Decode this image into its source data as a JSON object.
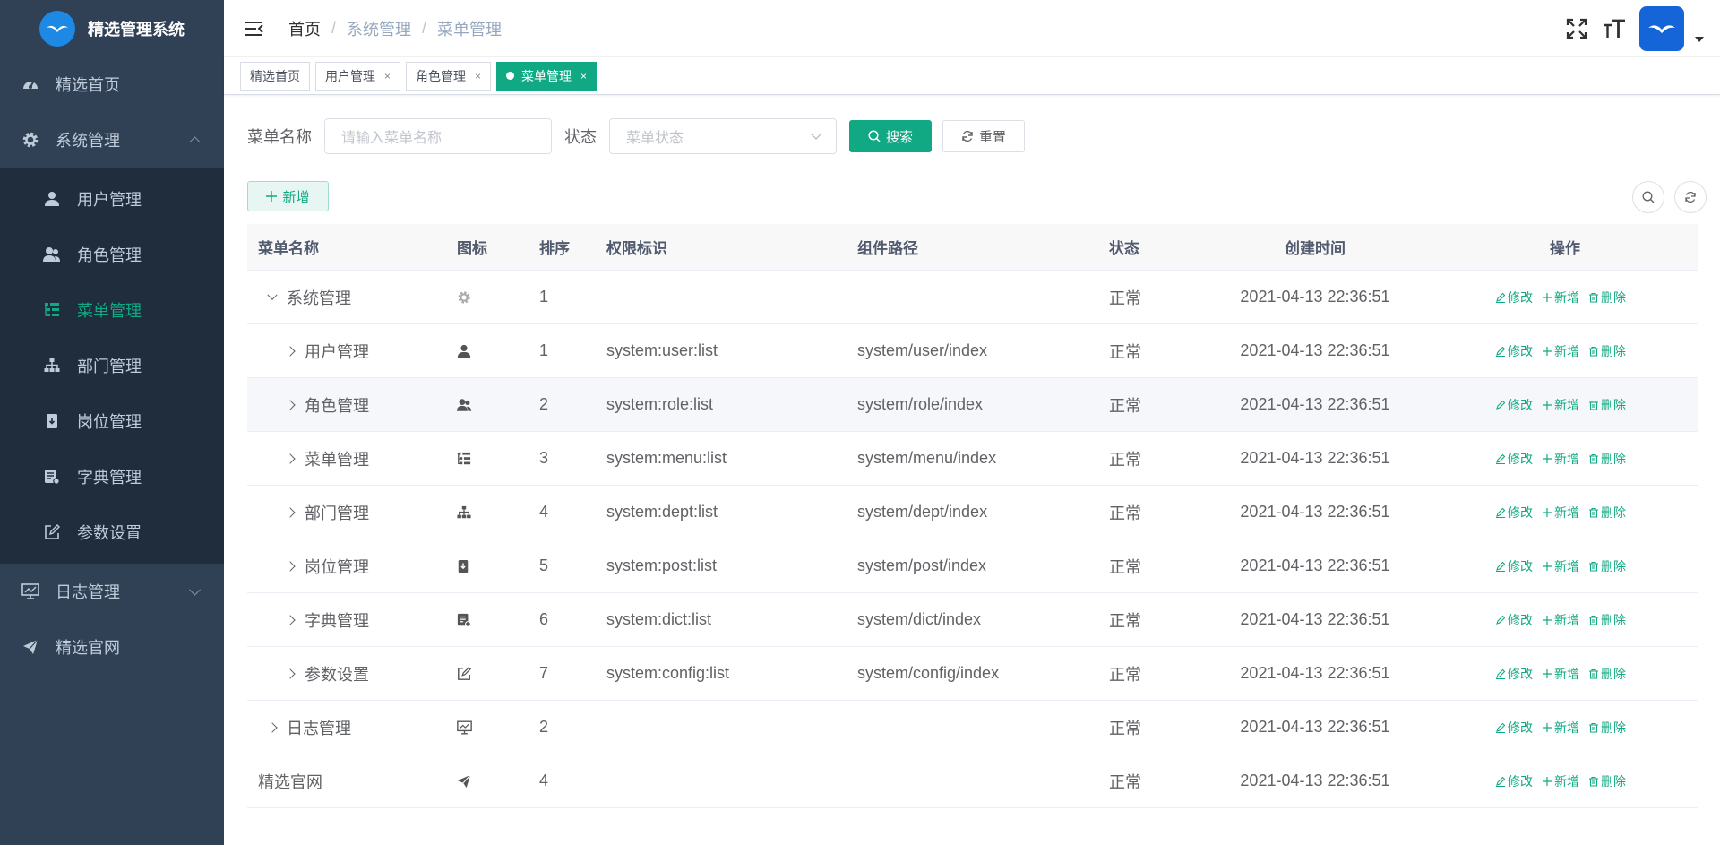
{
  "app": {
    "title": "精选管理系统"
  },
  "sidebar": {
    "items": [
      {
        "label": "精选首页",
        "icon": "dashboard-icon"
      },
      {
        "label": "系统管理",
        "icon": "gear-icon",
        "expanded": true
      },
      {
        "label": "日志管理",
        "icon": "monitor-icon",
        "expanded": false
      },
      {
        "label": "精选官网",
        "icon": "send-icon"
      }
    ],
    "sub": [
      {
        "label": "用户管理",
        "icon": "user-icon"
      },
      {
        "label": "角色管理",
        "icon": "peoples-icon"
      },
      {
        "label": "菜单管理",
        "icon": "tree-table-icon",
        "active": true
      },
      {
        "label": "部门管理",
        "icon": "tree-icon"
      },
      {
        "label": "岗位管理",
        "icon": "post-icon"
      },
      {
        "label": "字典管理",
        "icon": "dict-icon"
      },
      {
        "label": "参数设置",
        "icon": "edit-icon"
      }
    ]
  },
  "breadcrumb": [
    "首页",
    "系统管理",
    "菜单管理"
  ],
  "tags": [
    {
      "label": "精选首页",
      "closable": false
    },
    {
      "label": "用户管理",
      "closable": true
    },
    {
      "label": "角色管理",
      "closable": true
    },
    {
      "label": "菜单管理",
      "closable": true,
      "active": true
    }
  ],
  "tag_close": "×",
  "search": {
    "name_label": "菜单名称",
    "name_placeholder": "请输入菜单名称",
    "status_label": "状态",
    "status_placeholder": "菜单状态",
    "search_btn": "搜索",
    "reset_btn": "重置"
  },
  "toolbar": {
    "add_btn": "新增"
  },
  "table": {
    "headers": [
      "菜单名称",
      "图标",
      "排序",
      "权限标识",
      "组件路径",
      "状态",
      "创建时间",
      "操作"
    ],
    "ops": {
      "edit": "修改",
      "add": "新增",
      "delete": "删除"
    },
    "rows": [
      {
        "name": "系统管理",
        "icon": "gear-icon",
        "sort": "1",
        "perm": "",
        "comp": "",
        "status": "正常",
        "time": "2021-04-13 22:36:51",
        "level": 0,
        "toggle": "down"
      },
      {
        "name": "用户管理",
        "icon": "user-icon",
        "sort": "1",
        "perm": "system:user:list",
        "comp": "system/user/index",
        "status": "正常",
        "time": "2021-04-13 22:36:51",
        "level": 1,
        "toggle": "right"
      },
      {
        "name": "角色管理",
        "icon": "peoples-icon",
        "sort": "2",
        "perm": "system:role:list",
        "comp": "system/role/index",
        "status": "正常",
        "time": "2021-04-13 22:36:51",
        "level": 1,
        "toggle": "right",
        "hover": true
      },
      {
        "name": "菜单管理",
        "icon": "tree-table-icon",
        "sort": "3",
        "perm": "system:menu:list",
        "comp": "system/menu/index",
        "status": "正常",
        "time": "2021-04-13 22:36:51",
        "level": 1,
        "toggle": "right"
      },
      {
        "name": "部门管理",
        "icon": "tree-icon",
        "sort": "4",
        "perm": "system:dept:list",
        "comp": "system/dept/index",
        "status": "正常",
        "time": "2021-04-13 22:36:51",
        "level": 1,
        "toggle": "right"
      },
      {
        "name": "岗位管理",
        "icon": "post-icon",
        "sort": "5",
        "perm": "system:post:list",
        "comp": "system/post/index",
        "status": "正常",
        "time": "2021-04-13 22:36:51",
        "level": 1,
        "toggle": "right"
      },
      {
        "name": "字典管理",
        "icon": "dict-icon",
        "sort": "6",
        "perm": "system:dict:list",
        "comp": "system/dict/index",
        "status": "正常",
        "time": "2021-04-13 22:36:51",
        "level": 1,
        "toggle": "right"
      },
      {
        "name": "参数设置",
        "icon": "edit-icon",
        "sort": "7",
        "perm": "system:config:list",
        "comp": "system/config/index",
        "status": "正常",
        "time": "2021-04-13 22:36:51",
        "level": 1,
        "toggle": "right"
      },
      {
        "name": "日志管理",
        "icon": "monitor-icon",
        "sort": "2",
        "perm": "",
        "comp": "",
        "status": "正常",
        "time": "2021-04-13 22:36:51",
        "level": 0,
        "toggle": "right"
      },
      {
        "name": "精选官网",
        "icon": "send-icon",
        "sort": "4",
        "perm": "",
        "comp": "",
        "status": "正常",
        "time": "2021-04-13 22:36:51",
        "level": 0,
        "toggle": "none"
      }
    ]
  },
  "colors": {
    "primary": "#11a983",
    "sidebar_bg": "#304156",
    "submenu_bg": "#1f2d3d"
  }
}
